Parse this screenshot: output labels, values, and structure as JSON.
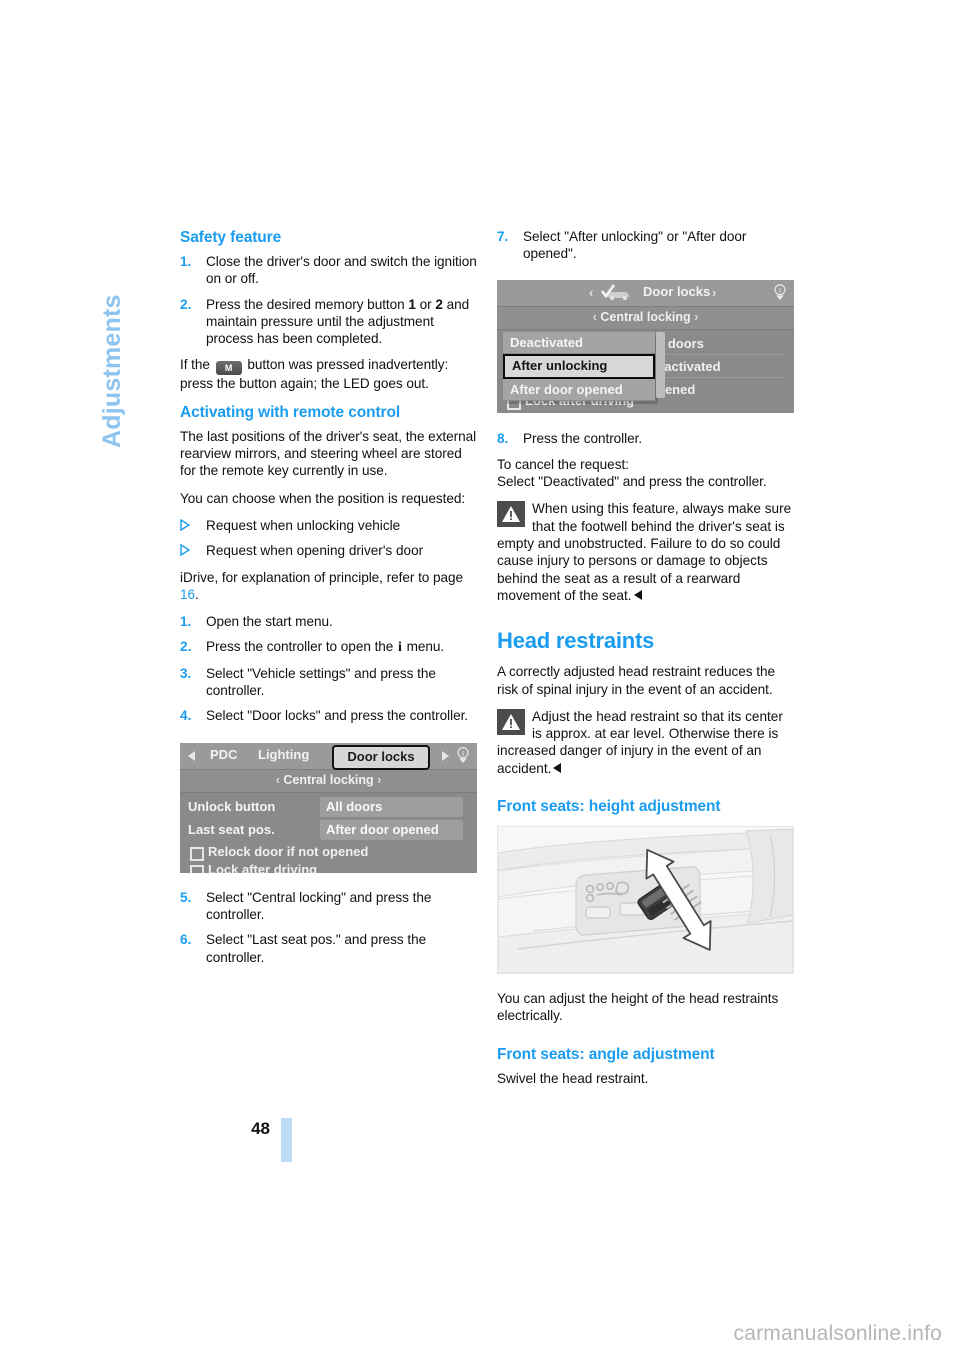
{
  "chapter": "Adjustments",
  "page_number": "48",
  "watermark": "carmanualsonline.info",
  "left_column": {
    "safety_heading": "Safety feature",
    "safety_steps": [
      {
        "num": "1.",
        "text": "Close the driver's door and switch the ignition on or off."
      },
      {
        "num": "2.",
        "text_a": "Press the desired memory button ",
        "bold_1": "1",
        "text_b": " or ",
        "bold_2": "2",
        "text_c": " and maintain pressure until the adjustment process has been completed."
      }
    ],
    "m_note_a": "If the ",
    "m_button_label": "M",
    "m_note_b": " button was pressed inadvertently: press the button again; the LED goes out.",
    "remote_heading": "Activating with remote control",
    "remote_intro": "The last positions of the driver's seat, the external rearview mirrors, and steering wheel are stored for the remote key currently in use.",
    "choose_intro": "You can choose when the position is requested:",
    "bullets": [
      "Request when unlocking vehicle",
      "Request when opening driver's door"
    ],
    "idrive_ref_a": "iDrive, for explanation of principle, refer to page ",
    "idrive_ref_page": "16",
    "idrive_ref_b": ".",
    "idrive_steps": [
      {
        "num": "1.",
        "text": "Open the start menu."
      },
      {
        "num": "2.",
        "text_a": "Press the controller to open the ",
        "glyph": "i",
        "text_b": " menu."
      },
      {
        "num": "3.",
        "text": "Select \"Vehicle settings\" and press the controller."
      },
      {
        "num": "4.",
        "text": "Select \"Door locks\" and press the controller."
      }
    ],
    "steps_after_fig": [
      {
        "num": "5.",
        "text": "Select \"Central locking\" and press the controller."
      },
      {
        "num": "6.",
        "text": "Select \"Last seat pos.\" and press the controller."
      }
    ],
    "idrive_figure": {
      "tabs": [
        "PDC",
        "Lighting"
      ],
      "selected_tab": "Door locks",
      "subtitle": "Central locking",
      "rows": [
        {
          "key": "Unlock button",
          "value": "All doors"
        },
        {
          "key": "Last seat pos.",
          "value": "After door opened"
        }
      ],
      "checkboxes": [
        "Relock door if not opened",
        "Lock after driving"
      ]
    }
  },
  "right_column": {
    "step7": {
      "num": "7.",
      "text": "Select \"After unlocking\" or \"After door opened\"."
    },
    "idrive_figure": {
      "title": "Door locks",
      "subtitle": "Central locking",
      "background_rows": [
        "ll doors",
        "eactivated",
        "pened"
      ],
      "checkbox": "Lock after driving",
      "dropdown_options": [
        "Deactivated",
        "After unlocking",
        "After door opened"
      ],
      "dropdown_selected": "After unlocking"
    },
    "step8": {
      "num": "8.",
      "text": "Press the controller."
    },
    "cancel_line1": "To cancel the request:",
    "cancel_line2": "Select \"Deactivated\" and press the controller.",
    "warning_1": "When using this feature, always make sure that the footwell behind the driver's seat is empty and unobstructed. Failure to do so could cause injury to persons or damage to objects behind the seat as a result of a rearward movement of the seat.",
    "head_restraints_heading": "Head restraints",
    "head_restraints_intro": "A correctly adjusted head restraint reduces the risk of spinal injury in the event of an accident.",
    "warning_2": "Adjust the head restraint so that its center is approx. at ear level. Otherwise there is increased danger of injury in the event of an accident.",
    "height_heading": "Front seats: height adjustment",
    "height_body": "You can adjust the height of the head restraints electrically.",
    "angle_heading": "Front seats: angle adjustment",
    "angle_body": "Swivel the head restraint."
  },
  "colors": {
    "accent_blue": "#1a9cf0",
    "tab_blue": "#8ec4f0",
    "page_bar_blue": "#bfdcf7",
    "screen_gray": "#8a8a8a"
  }
}
